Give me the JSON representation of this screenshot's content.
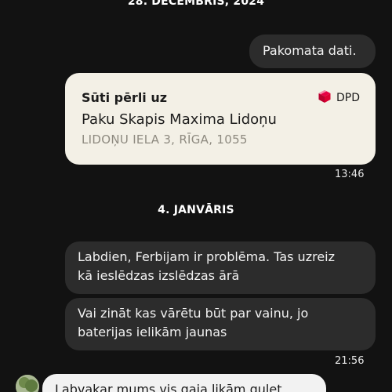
{
  "chat": {
    "date_1": "28. DECEMBRIS, 2024",
    "date_2": "4. JANVĀRIS",
    "msg_outgoing_1": "Pakomata dati.",
    "parcel_card": {
      "title": "Sūti pērli uz",
      "brand": "DPD",
      "brand_icon": "dpd-cube-icon",
      "brand_color": "#dc0032",
      "locker_name": "Paku Skapis Maxima Lidoņu",
      "address": "LIDOŅU IELA 3, RĪGA, 1055"
    },
    "time_1": "13:46",
    "msg_in_1_line1": "Labdien, Ferbijam ir problēma. Tas uzreiz",
    "msg_in_1_line2": "kā ieslēdzas izslēdzas ārā",
    "msg_in_2_line1": "Vai zināt kas vārētu būt par vainu, jo",
    "msg_in_2_line2": "baterijas ielikām jaunas",
    "time_2": "21:56",
    "msg_partial": "Labvakar mums vis gaja likām gulet"
  }
}
